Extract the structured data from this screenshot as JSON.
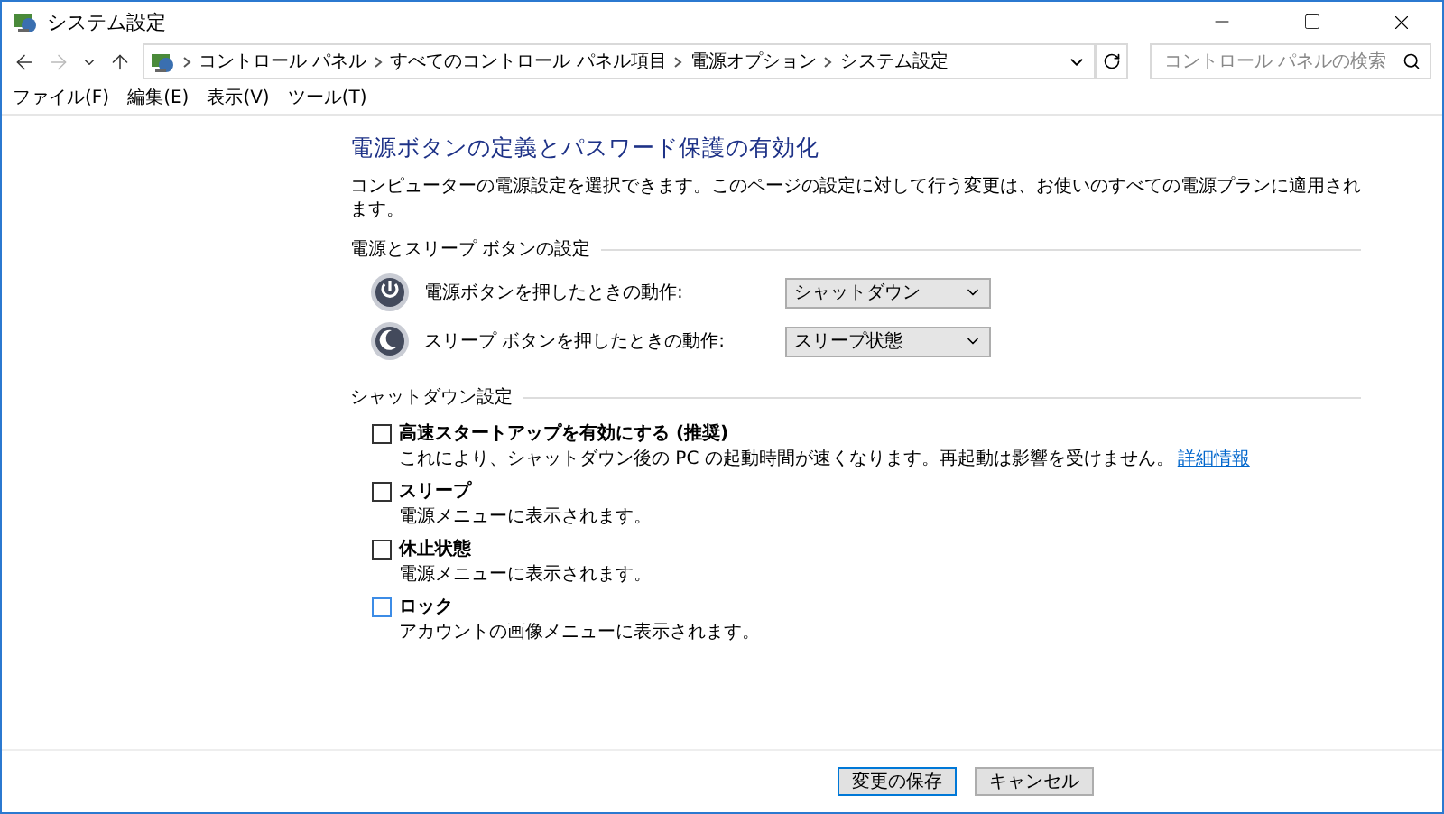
{
  "window": {
    "title": "システム設定"
  },
  "address_bar": {
    "breadcrumbs": [
      "コントロール パネル",
      "すべてのコントロール パネル項目",
      "電源オプション",
      "システム設定"
    ]
  },
  "search": {
    "placeholder": "コントロール パネルの検索"
  },
  "menu": [
    "ファイル(F)",
    "編集(E)",
    "表示(V)",
    "ツール(T)"
  ],
  "heading": "電源ボタンの定義とパスワード保護の有効化",
  "description": "コンピューターの電源設定を選択できます。このページの設定に対して行う変更は、お使いのすべての電源プランに適用されます。",
  "button_section": {
    "title": "電源とスリープ ボタンの設定",
    "rows": [
      {
        "kind": "power",
        "label": "電源ボタンを押したときの動作:",
        "value": "シャットダウン"
      },
      {
        "kind": "sleep",
        "label": "スリープ ボタンを押したときの動作:",
        "value": "スリープ状態"
      }
    ]
  },
  "shutdown_section": {
    "title": "シャットダウン設定",
    "options": [
      {
        "label": "高速スタートアップを有効にする (推奨)",
        "checked": false,
        "hovered": false,
        "description": "これにより、シャットダウン後の PC の起動時間が速くなります。再起動は影響を受けません。",
        "link": "詳細情報"
      },
      {
        "label": "スリープ",
        "checked": false,
        "hovered": false,
        "description": "電源メニューに表示されます。"
      },
      {
        "label": "休止状態",
        "checked": false,
        "hovered": false,
        "description": "電源メニューに表示されます。"
      },
      {
        "label": "ロック",
        "checked": false,
        "hovered": true,
        "description": "アカウントの画像メニューに表示されます。"
      }
    ]
  },
  "buttons": [
    "変更の保存",
    "キャンセル"
  ]
}
